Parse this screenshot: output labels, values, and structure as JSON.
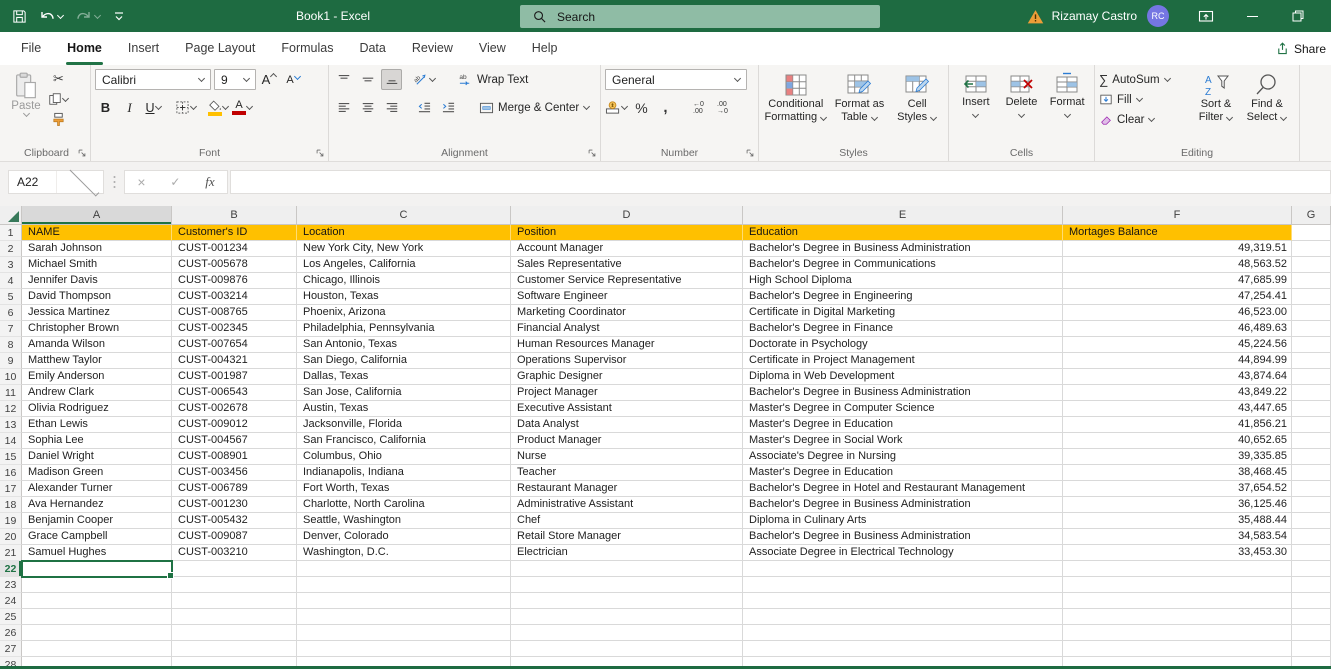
{
  "titlebar": {
    "title": "Book1  -  Excel",
    "search": "Search",
    "user": "Rizamay Castro",
    "initials": "RC"
  },
  "tabs": {
    "items": [
      "File",
      "Home",
      "Insert",
      "Page Layout",
      "Formulas",
      "Data",
      "Review",
      "View",
      "Help"
    ],
    "active": "Home",
    "share": "Share"
  },
  "ribbon": {
    "clipboard": {
      "label": "Clipboard",
      "paste": "Paste"
    },
    "font": {
      "label": "Font",
      "family": "Calibri",
      "size": "9"
    },
    "alignment": {
      "label": "Alignment",
      "wrap": "Wrap Text",
      "merge": "Merge & Center"
    },
    "number": {
      "label": "Number",
      "format": "General"
    },
    "styles": {
      "label": "Styles",
      "conditional1": "Conditional",
      "conditional2": "Formatting",
      "table1": "Format as",
      "table2": "Table",
      "cell1": "Cell",
      "cell2": "Styles"
    },
    "cells": {
      "label": "Cells",
      "insert": "Insert",
      "delete": "Delete",
      "format": "Format"
    },
    "editing": {
      "label": "Editing",
      "autosum": "AutoSum",
      "fill": "Fill",
      "clear": "Clear",
      "sort1": "Sort &",
      "sort2": "Filter",
      "find1": "Find &",
      "find2": "Select"
    }
  },
  "formula_bar": {
    "name_box": "A22",
    "formula": ""
  },
  "grid": {
    "selected_cell": "A22",
    "selected_column": "A",
    "selected_row": 22,
    "last_row_number": 28,
    "columns": [
      "A",
      "B",
      "C",
      "D",
      "E",
      "F",
      "G"
    ],
    "header_row": [
      "NAME",
      "Customer's ID",
      "Location",
      "Position",
      "Education",
      "Mortages Balance"
    ],
    "rows": [
      {
        "name": "Sarah Johnson",
        "customer_id": "CUST-001234",
        "location": "New York City, New York",
        "position": "Account Manager",
        "education": "Bachelor's Degree in Business Administration",
        "balance": "49,319.51"
      },
      {
        "name": "Michael Smith",
        "customer_id": "CUST-005678",
        "location": "Los Angeles, California",
        "position": "Sales Representative",
        "education": "Bachelor's Degree in Communications",
        "balance": "48,563.52"
      },
      {
        "name": "Jennifer Davis",
        "customer_id": "CUST-009876",
        "location": "Chicago, Illinois",
        "position": "Customer Service Representative",
        "education": "High School Diploma",
        "balance": "47,685.99"
      },
      {
        "name": "David Thompson",
        "customer_id": "CUST-003214",
        "location": "Houston, Texas",
        "position": "Software Engineer",
        "education": "Bachelor's Degree in Engineering",
        "balance": "47,254.41"
      },
      {
        "name": "Jessica Martinez",
        "customer_id": "CUST-008765",
        "location": "Phoenix, Arizona",
        "position": "Marketing Coordinator",
        "education": "Certificate in Digital Marketing",
        "balance": "46,523.00"
      },
      {
        "name": "Christopher Brown",
        "customer_id": "CUST-002345",
        "location": "Philadelphia, Pennsylvania",
        "position": "Financial Analyst",
        "education": "Bachelor's Degree in Finance",
        "balance": "46,489.63"
      },
      {
        "name": "Amanda Wilson",
        "customer_id": "CUST-007654",
        "location": "San Antonio, Texas",
        "position": "Human Resources Manager",
        "education": "Doctorate in Psychology",
        "balance": "45,224.56"
      },
      {
        "name": "Matthew Taylor",
        "customer_id": "CUST-004321",
        "location": "San Diego, California",
        "position": "Operations Supervisor",
        "education": "Certificate in Project Management",
        "balance": "44,894.99"
      },
      {
        "name": "Emily Anderson",
        "customer_id": "CUST-001987",
        "location": "Dallas, Texas",
        "position": "Graphic Designer",
        "education": "Diploma in Web Development",
        "balance": "43,874.64"
      },
      {
        "name": "Andrew Clark",
        "customer_id": "CUST-006543",
        "location": "San Jose, California",
        "position": "Project Manager",
        "education": "Bachelor's Degree in Business Administration",
        "balance": "43,849.22"
      },
      {
        "name": "Olivia Rodriguez",
        "customer_id": "CUST-002678",
        "location": "Austin, Texas",
        "position": "Executive Assistant",
        "education": "Master's Degree in Computer Science",
        "balance": "43,447.65"
      },
      {
        "name": "Ethan Lewis",
        "customer_id": "CUST-009012",
        "location": "Jacksonville, Florida",
        "position": "Data Analyst",
        "education": "Master's Degree in Education",
        "balance": "41,856.21"
      },
      {
        "name": "Sophia Lee",
        "customer_id": "CUST-004567",
        "location": "San Francisco, California",
        "position": "Product Manager",
        "education": "Master's Degree in Social Work",
        "balance": "40,652.65"
      },
      {
        "name": "Daniel Wright",
        "customer_id": "CUST-008901",
        "location": "Columbus, Ohio",
        "position": "Nurse",
        "education": "Associate's Degree in Nursing",
        "balance": "39,335.85"
      },
      {
        "name": "Madison Green",
        "customer_id": "CUST-003456",
        "location": "Indianapolis, Indiana",
        "position": "Teacher",
        "education": "Master's Degree in Education",
        "balance": "38,468.45"
      },
      {
        "name": "Alexander Turner",
        "customer_id": "CUST-006789",
        "location": "Fort Worth, Texas",
        "position": "Restaurant Manager",
        "education": "Bachelor's Degree in Hotel and Restaurant Management",
        "balance": "37,654.52"
      },
      {
        "name": "Ava Hernandez",
        "customer_id": "CUST-001230",
        "location": "Charlotte, North Carolina",
        "position": "Administrative Assistant",
        "education": "Bachelor's Degree in Business Administration",
        "balance": "36,125.46"
      },
      {
        "name": "Benjamin Cooper",
        "customer_id": "CUST-005432",
        "location": "Seattle, Washington",
        "position": "Chef",
        "education": "Diploma in Culinary Arts",
        "balance": "35,488.44"
      },
      {
        "name": "Grace Campbell",
        "customer_id": "CUST-009087",
        "location": "Denver, Colorado",
        "position": "Retail Store Manager",
        "education": "Bachelor's Degree in Business Administration",
        "balance": "34,583.54"
      },
      {
        "name": "Samuel Hughes",
        "customer_id": "CUST-003210",
        "location": "Washington, D.C.",
        "position": "Electrician",
        "education": "Associate Degree in Electrical Technology",
        "balance": "33,453.30"
      }
    ]
  },
  "colors": {
    "titlebar_green": "#1E6B41",
    "accent_green": "#217346",
    "selection_green": "#1F7244",
    "header_fill": "#FFC000",
    "avatar": "#7576E2",
    "warning_orange": "#ED9E38"
  }
}
